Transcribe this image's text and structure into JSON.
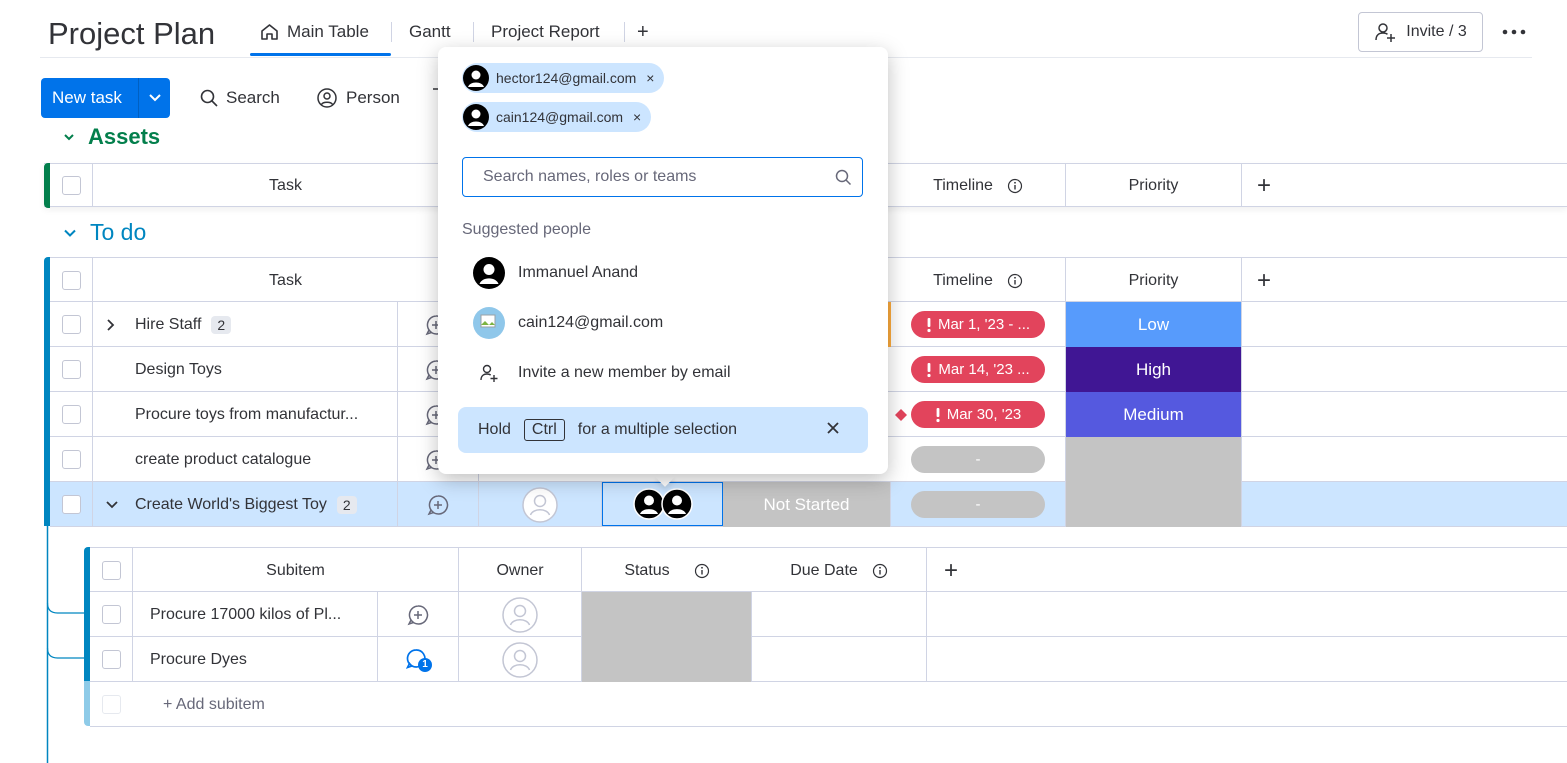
{
  "header": {
    "title": "Project Plan",
    "tabs": [
      {
        "label": "Main Table",
        "icon": "home-icon"
      },
      {
        "label": "Gantt"
      },
      {
        "label": "Project Report"
      }
    ],
    "add_tab_label": "+",
    "invite_label": "Invite / 3",
    "more_label": "..."
  },
  "toolbar": {
    "new_task_label": "New task",
    "search_label": "Search",
    "person_label": "Person"
  },
  "colors": {
    "accent": "#0073ea",
    "group_assets": "#037f4c",
    "group_todo": "#0086c0",
    "priority_low": "#579bfc",
    "priority_high": "#401694",
    "priority_medium": "#5559df",
    "timeline_overdue": "#e2445c",
    "status_empty": "#c4c4c4",
    "selected_row": "#cce5ff"
  },
  "groups": {
    "assets": {
      "title": "Assets",
      "columns": {
        "task": "Task",
        "timeline": "Timeline",
        "priority": "Priority",
        "add": "+"
      }
    },
    "todo": {
      "title": "To do",
      "columns": {
        "task": "Task",
        "timeline": "Timeline",
        "priority": "Priority",
        "add": "+"
      },
      "rows": [
        {
          "task": "Hire Staff",
          "subitems": "2",
          "timeline": "Mar 1, '23 - ...",
          "priority": "Low"
        },
        {
          "task": "Design Toys",
          "timeline": "Mar 14, '23 ...",
          "priority": "High"
        },
        {
          "task": "Procure toys from manufactur...",
          "timeline": "Mar 30, '23",
          "priority": "Medium"
        },
        {
          "task": "create product catalogue",
          "timeline": "-",
          "priority": ""
        },
        {
          "task": "Create World's Biggest Toy",
          "subitems": "2",
          "status": "Not Started",
          "timeline": "-",
          "priority": ""
        }
      ]
    }
  },
  "subitems": {
    "columns": {
      "subitem": "Subitem",
      "owner": "Owner",
      "status": "Status",
      "due_date": "Due Date",
      "add": "+"
    },
    "rows": [
      {
        "name": "Procure 17000 kilos of Pl...",
        "updates": ""
      },
      {
        "name": "Procure Dyes",
        "updates": "1"
      }
    ],
    "add_label": "+ Add subitem"
  },
  "popup": {
    "selected": [
      {
        "email": "hector124@gmail.com"
      },
      {
        "email": "cain124@gmail.com"
      }
    ],
    "remove_label": "×",
    "search_placeholder": "Search names, roles or teams",
    "suggested_label": "Suggested people",
    "people": [
      {
        "name": "Immanuel Anand"
      },
      {
        "name": "cain124@gmail.com"
      }
    ],
    "invite_label": "Invite a new member by email",
    "hint": {
      "hold": "Hold",
      "key": "Ctrl",
      "rest": "for a multiple selection"
    }
  }
}
